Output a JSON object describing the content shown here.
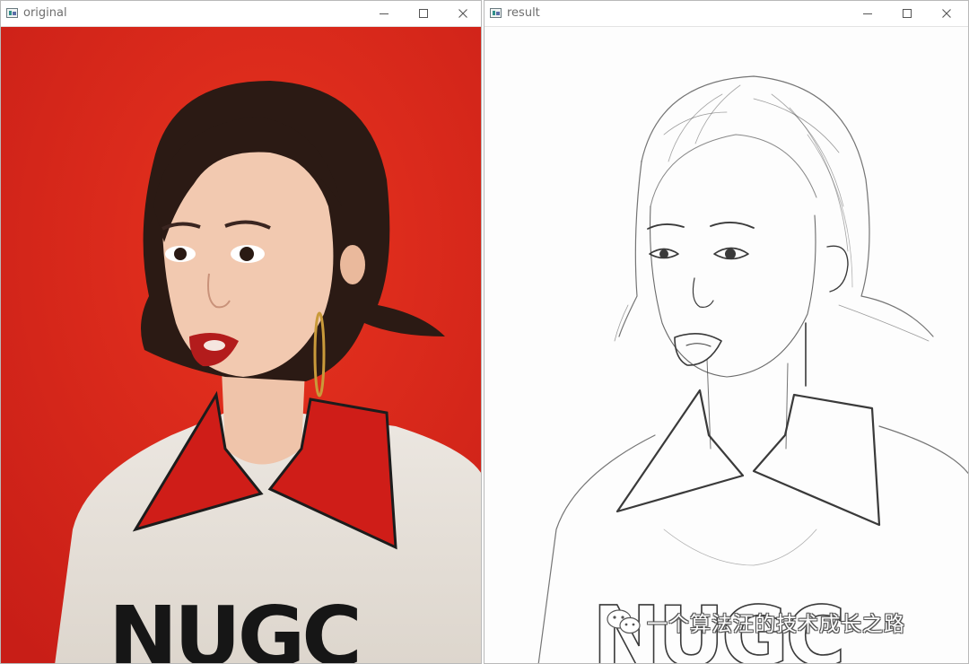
{
  "windows": [
    {
      "title": "original"
    },
    {
      "title": "result"
    }
  ],
  "watermark": {
    "text": "一个算法汪的技术成长之路"
  },
  "icons": {
    "app": "opencv-window-icon",
    "minimize": "minimize-icon",
    "maximize": "maximize-icon",
    "close": "close-icon",
    "wechat": "wechat-icon"
  },
  "colors": {
    "backdrop_red": "#d9261c",
    "sweater": "#e9e3dc",
    "collar_red": "#cf1d18",
    "hair": "#2b1a14",
    "skin": "#f2c9b0",
    "sketch_line": "#3a3a3a"
  }
}
